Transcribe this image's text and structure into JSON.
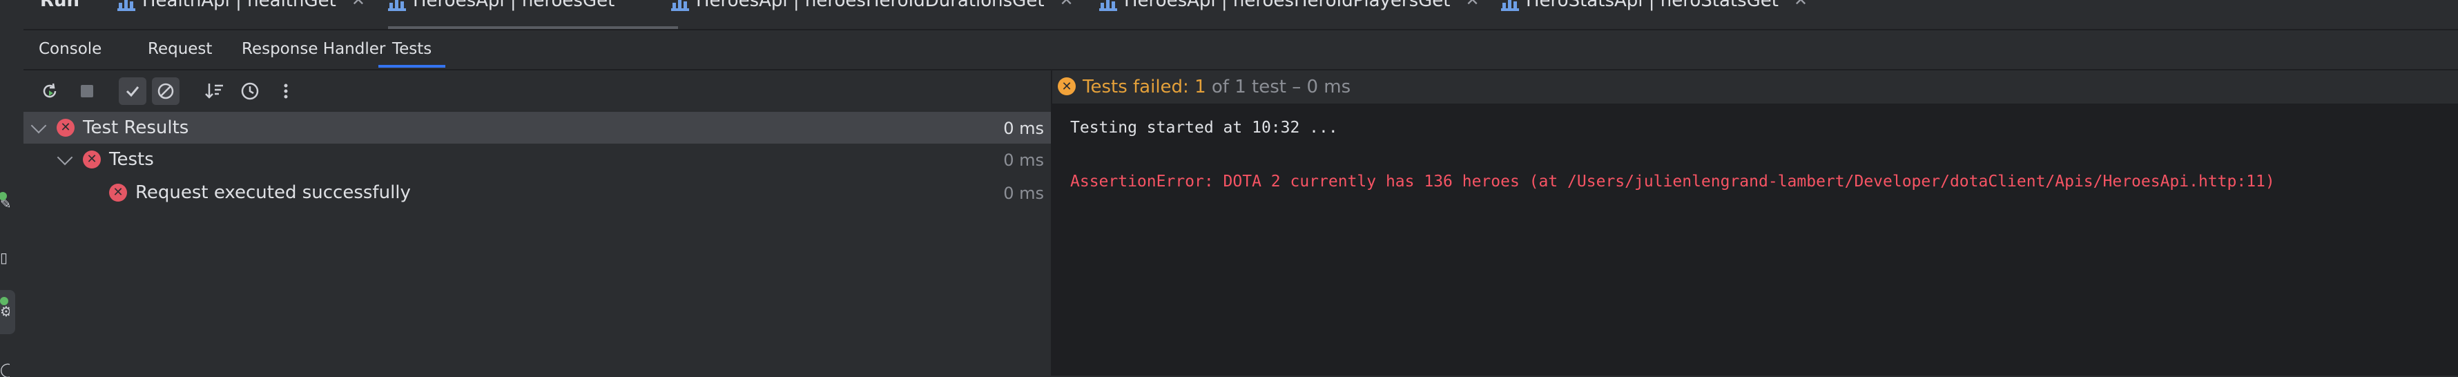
{
  "run_bar": {
    "title": "Run",
    "tabs": [
      {
        "label": "HealthApi | healthGet"
      },
      {
        "label": "HeroesApi | heroesGet"
      },
      {
        "label": "HeroesApi | heroesHeroIdDurationsGet"
      },
      {
        "label": "HeroesApi | heroesHeroIdPlayersGet"
      },
      {
        "label": "HeroStatsApi | heroStatsGet"
      }
    ],
    "active_tab_index": 1
  },
  "sub_tabs": {
    "items": [
      {
        "label": "Console"
      },
      {
        "label": "Request"
      },
      {
        "label": "Response Handler"
      },
      {
        "label": "Tests"
      }
    ],
    "selected": "Tests"
  },
  "toolbar": {
    "buttons": [
      {
        "name": "rerun-icon"
      },
      {
        "name": "stop-icon"
      },
      {
        "name": "show-passed-icon"
      },
      {
        "name": "show-ignored-icon"
      },
      {
        "name": "sort-icon"
      },
      {
        "name": "history-icon"
      },
      {
        "name": "more-icon"
      }
    ]
  },
  "tree": {
    "root": {
      "label": "Test Results",
      "time": "0 ms",
      "status": "failed"
    },
    "suite": {
      "label": "Tests",
      "time": "0 ms",
      "status": "failed"
    },
    "test": {
      "label": "Request executed successfully",
      "time": "0 ms",
      "status": "failed"
    }
  },
  "status": {
    "prefix": "Tests failed: ",
    "failed_count": "1",
    "suffix": " of 1 test – 0 ms"
  },
  "console": {
    "started": "Testing started at 10:32 ...",
    "error": "AssertionError: DOTA 2 currently has 136 heroes (at /Users/julienlengrand-lambert/Developer/dotaClient/Apis/HeroesApi.http:11)"
  },
  "colors": {
    "background": "#2b2d30",
    "console_bg": "#1e1f22",
    "accent": "#3574f0",
    "error": "#f75464",
    "warning": "#f2a33a",
    "fail_icon": "#e55765"
  }
}
